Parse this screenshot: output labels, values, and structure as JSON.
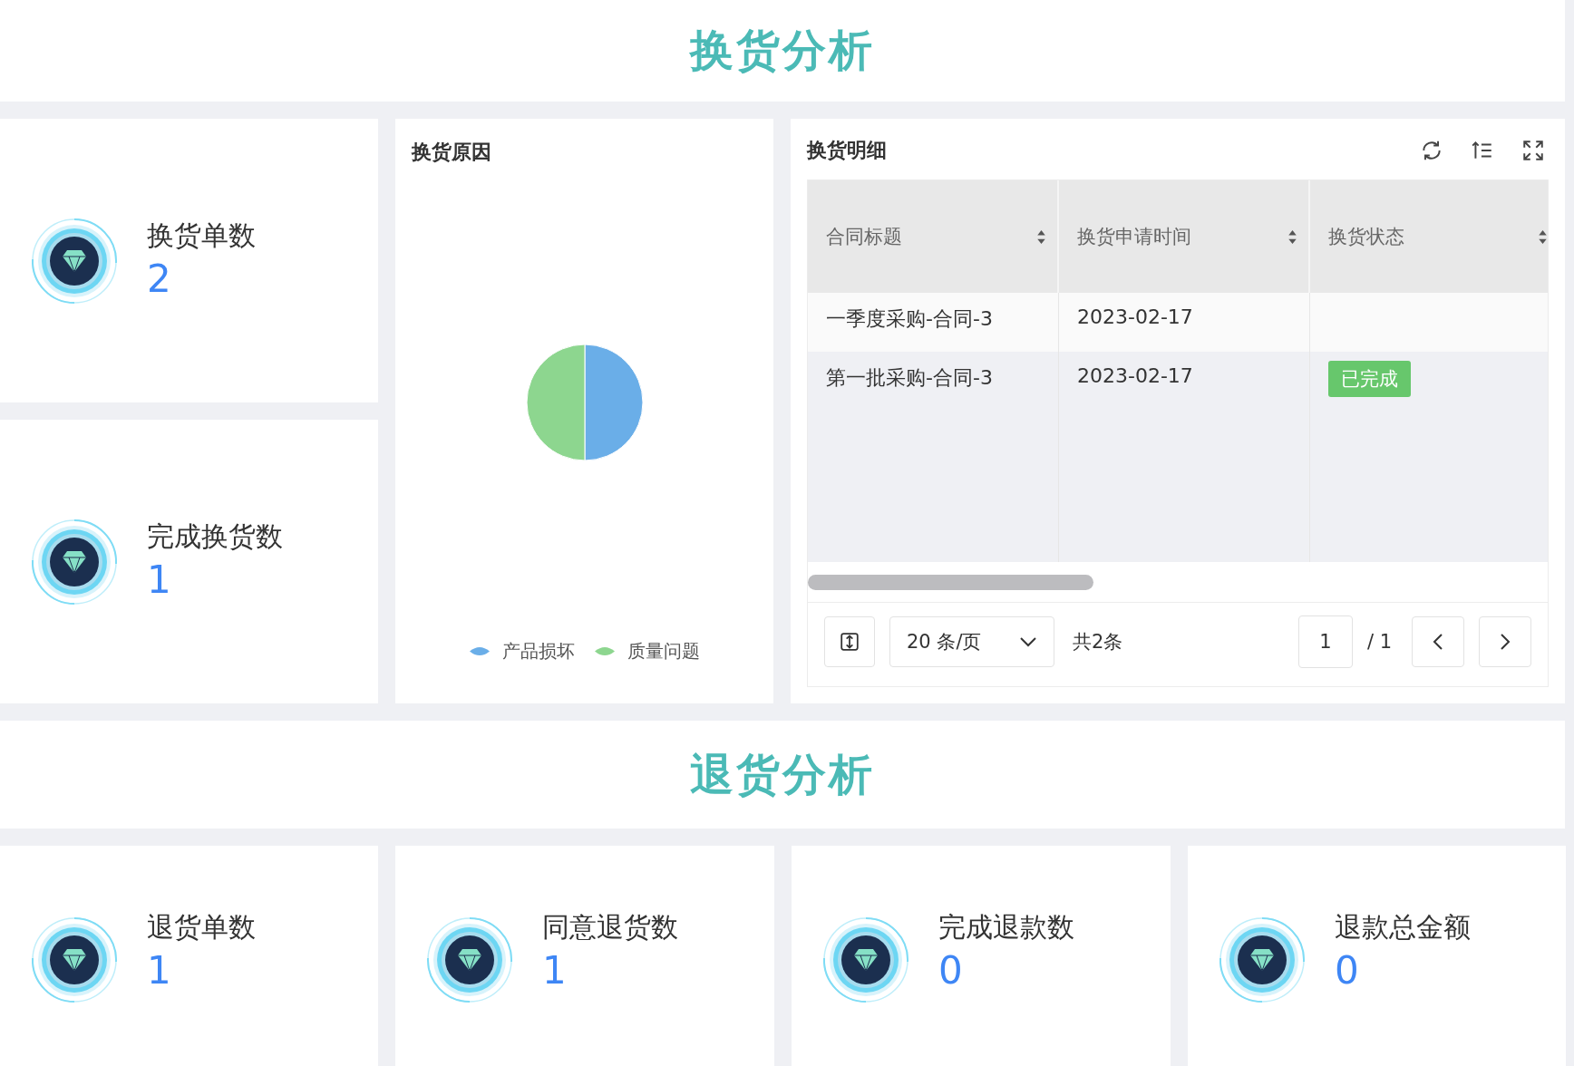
{
  "sections": [
    {
      "title": "换货分析"
    },
    {
      "title": "退货分析"
    }
  ],
  "exchange_stats": [
    {
      "label": "换货单数",
      "value": "2"
    },
    {
      "label": "完成换货数",
      "value": "1"
    }
  ],
  "reason_panel": {
    "title": "换货原因",
    "legend": [
      {
        "label": "产品损坏",
        "color": "#6aaee8"
      },
      {
        "label": "质量问题",
        "color": "#8dd68f"
      }
    ]
  },
  "detail_panel": {
    "title": "换货明细",
    "columns": [
      "合同标题",
      "换货申请时间",
      "换货状态"
    ],
    "rows": [
      {
        "cells": [
          "一季度采购-合同-3",
          "2023-02-17"
        ],
        "status": null
      },
      {
        "cells": [
          "第一批采购-合同-3",
          "2023-02-17"
        ],
        "status": {
          "text": "已完成",
          "color": "#67c76c"
        }
      }
    ],
    "pagination": {
      "page_size": "20 条/页",
      "total": "共2条",
      "page": "1",
      "pages": "/ 1"
    }
  },
  "return_stats": [
    {
      "label": "退货单数",
      "value": "1"
    },
    {
      "label": "同意退货数",
      "value": "1"
    },
    {
      "label": "完成退款数",
      "value": "0"
    },
    {
      "label": "退款总金额",
      "value": "0"
    }
  ]
}
